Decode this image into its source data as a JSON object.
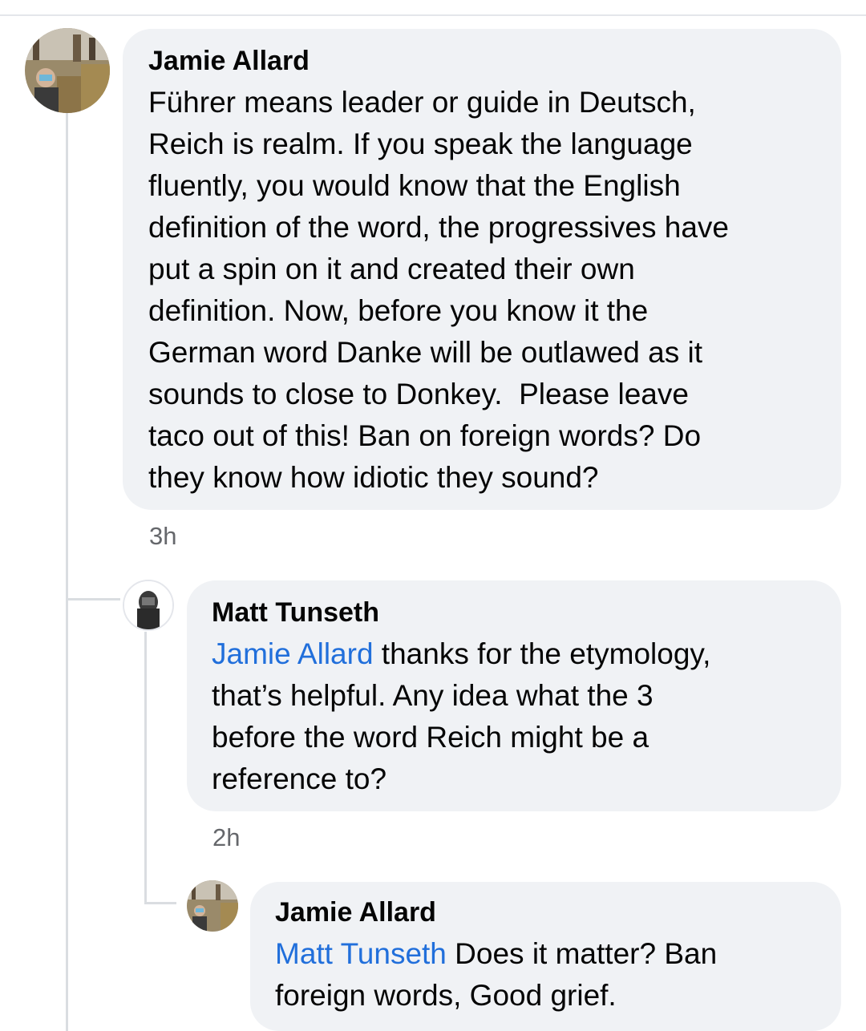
{
  "comments": [
    {
      "author": "Jamie Allard",
      "mention": "",
      "text": "Führer means leader or guide in Deutsch,\nReich is realm. If you speak the language\nfluently, you would know that the English\ndefinition of the word, the progressives have\nput a spin on it and created their own\ndefinition. Now, before you know it the\nGerman word Danke will be outlawed as it\nsounds to close to Donkey.  Please leave\ntaco out of this! Ban on foreign words? Do\nthey know how idiotic they sound?",
      "time": "3h"
    },
    {
      "author": "Matt Tunseth",
      "mention": "Jamie Allard",
      "text": " thanks for the etymology,\nthat’s helpful. Any idea what the 3\nbefore the word Reich might be a\nreference to?",
      "time": "2h"
    },
    {
      "author": "Jamie Allard",
      "mention": "Matt Tunseth",
      "text": " Does it matter? Ban\nforeign words, Good grief.",
      "time": ""
    }
  ],
  "colors": {
    "bubble": "#f0f2f5",
    "mention": "#216fdb",
    "timestamp": "#65676b",
    "thread_line": "#dadde1"
  }
}
